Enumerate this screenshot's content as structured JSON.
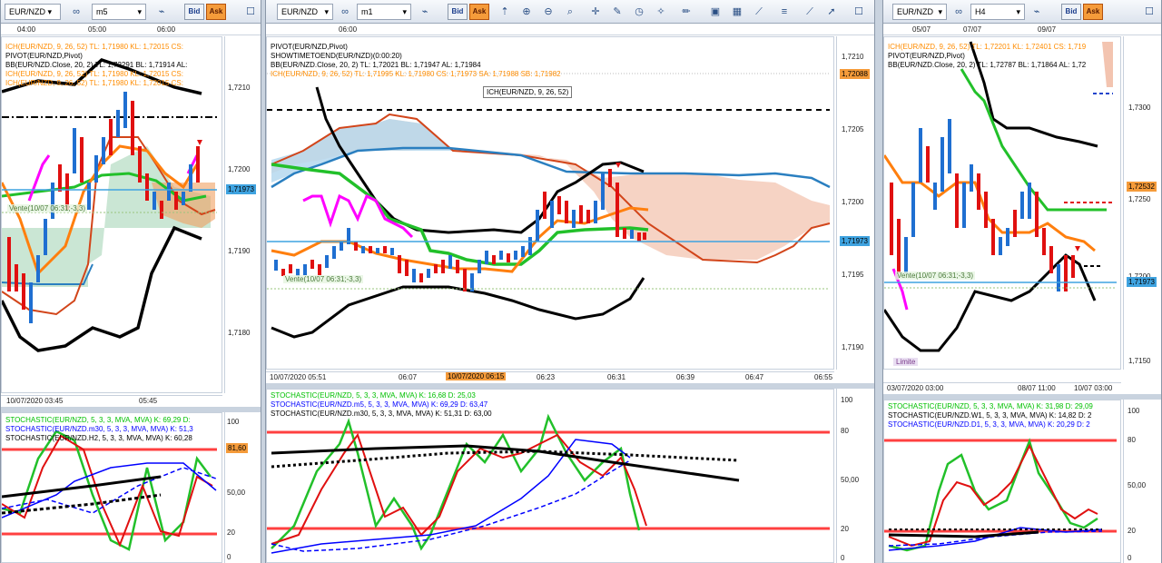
{
  "panels": [
    {
      "id": "left",
      "symbol": "EUR/NZD",
      "timeframe": "m5",
      "bid": "Bid",
      "ask": "Ask",
      "top_times": [
        "04:00",
        "05:00",
        "06:00"
      ],
      "legend": [
        {
          "text": "ICH(EUR/NZD, 9, 26, 52)  TL: 1,71980  KL: 1,72015  CS:",
          "color": "#ff8c00"
        },
        {
          "text": "PIVOT(EUR/NZD,Pivot)",
          "color": "#000000"
        },
        {
          "text": "BB(EUR/NZD.Close, 20, 2)  TL: 1,72291  BL: 1,71914  AL:",
          "color": "#000000"
        },
        {
          "text": "ICH(EUR/NZD, 9, 26, 52)  TL: 1,71980  KL: 1,72015  CS:",
          "color": "#ff8c00"
        },
        {
          "text": "ICH(EUR/NZD, 9, 26, 52)  TL: 1,71980  KL: 1,72015  CS:",
          "color": "#ff8c00"
        }
      ],
      "prices": [
        "1,7210",
        "1,7200",
        "1,7190",
        "1,7180"
      ],
      "current_price": "1,71973",
      "order_label": "Vente(10/07 06:31;-3,3)",
      "bottom_times": [
        "10/07/2020 03:45",
        "05:45"
      ],
      "stoch_legend": [
        {
          "text": "STOCHASTIC(EUR/NZD, 5, 3, 3, MVA, MVA)  K: 69,29  D:",
          "color": "#00c000"
        },
        {
          "text": "STOCHASTIC(EUR/NZD.m30, 5, 3, 3, MVA, MVA)  K: 51,3",
          "color": "#0000ff"
        },
        {
          "text": "STOCHASTIC(EUR/NZD.H2, 5, 3, 3, MVA, MVA)  K: 60,28",
          "color": "#000000"
        }
      ],
      "stoch_levels": [
        "100",
        "50,00",
        "20",
        "0"
      ],
      "stoch_highlight": "81,60"
    },
    {
      "id": "middle",
      "symbol": "EUR/NZD",
      "timeframe": "m1",
      "bid": "Bid",
      "ask": "Ask",
      "top_times": [
        "06:00"
      ],
      "legend": [
        {
          "text": "PIVOT(EUR/NZD,Pivot)",
          "color": "#000000"
        },
        {
          "text": "SHOWTIMETOEND(EUR/NZD)(0:00:20)",
          "color": "#000000"
        },
        {
          "text": "BB(EUR/NZD.Close, 20, 2)  TL: 1,72021  BL: 1,71947  AL: 1,71984",
          "color": "#000000"
        },
        {
          "text": "ICH(EUR/NZD, 9, 26, 52)  TL: 1,71995  KL: 1,71980  CS: 1,71973  SA: 1,71988  SB: 1,71982",
          "color": "#ff8c00"
        }
      ],
      "tooltip": "ICH(EUR/NZD, 9, 26, 52)",
      "prices": [
        "1,7210",
        "1,7205",
        "1,7200",
        "1,7195",
        "1,7190"
      ],
      "pivot_price": "1,72088",
      "current_price": "1,71973",
      "order_label": "Vente(10/07 06:31;-3,3)",
      "bottom_times": [
        "10/07/2020 05:51",
        "06:07",
        "10/07/2020 06:15",
        "06:23",
        "06:31",
        "06:39",
        "06:47",
        "06:55"
      ],
      "stoch_legend": [
        {
          "text": "STOCHASTIC(EUR/NZD, 5, 3, 3, MVA, MVA)  K: 16,68  D: 25,03",
          "color": "#00c000"
        },
        {
          "text": "STOCHASTIC(EUR/NZD.m5, 5, 3, 3, MVA, MVA)  K: 69,29  D: 63,47",
          "color": "#0000ff"
        },
        {
          "text": "STOCHASTIC(EUR/NZD.m30, 5, 3, 3, MVA, MVA)  K: 51,31  D: 63,00",
          "color": "#000000"
        }
      ],
      "stoch_levels": [
        "100",
        "80",
        "50,00",
        "20",
        "0"
      ]
    },
    {
      "id": "right",
      "symbol": "EUR/NZD",
      "timeframe": "H4",
      "bid": "Bid",
      "ask": "Ask",
      "top_times": [
        "05/07",
        "07/07",
        "09/07"
      ],
      "legend": [
        {
          "text": "ICH(EUR/NZD, 9, 26, 52)  TL: 1,72201  KL: 1,72401  CS: 1,719",
          "color": "#ff8c00"
        },
        {
          "text": "PIVOT(EUR/NZD,Pivot)",
          "color": "#000000"
        },
        {
          "text": "BB(EUR/NZD.Close, 20, 2)  TL: 1,72787  BL: 1,71864  AL: 1,72",
          "color": "#000000"
        }
      ],
      "prices": [
        "1,7300",
        "1,7250",
        "1,7200",
        "1,7150"
      ],
      "pivot_price": "1,72532",
      "current_price": "1,71973",
      "order_label": "Vente(10/07 06:31;-3,3)",
      "limit_label": "Limite",
      "bottom_times": [
        "03/07/2020 03:00",
        "08/07 11:00",
        "10/07 03:00"
      ],
      "stoch_legend": [
        {
          "text": "STOCHASTIC(EUR/NZD, 5, 3, 3, MVA, MVA)  K: 31,98  D: 29,09",
          "color": "#00c000"
        },
        {
          "text": "STOCHASTIC(EUR/NZD.W1, 5, 3, 3, MVA, MVA)  K: 14,82  D: 2",
          "color": "#000000"
        },
        {
          "text": "STOCHASTIC(EUR/NZD.D1, 5, 3, 3, MVA, MVA)  K: 20,29  D: 2",
          "color": "#0000ff"
        }
      ],
      "stoch_levels": [
        "100",
        "80",
        "50,00",
        "20",
        "0"
      ]
    }
  ],
  "colors": {
    "bull": "#1f6fd1",
    "bear": "#e01010",
    "tenkan": "#ff7f0e",
    "kijun": "#22c02a",
    "chikou": "#ff00ff",
    "bands": "#000000",
    "span_b": "#d2451a",
    "span_a": "#2a7fc0",
    "pivot": "#000000",
    "price_tag": "#3fa3e0",
    "pivot_tag": "#f59b3a"
  },
  "icons": [
    "symbol-dropdown-icon",
    "chart-type-icon",
    "timeframe-dropdown-icon",
    "indicator-icon",
    "crosshair-icon",
    "zoom-in-icon",
    "zoom-out-icon",
    "draw-line-icon",
    "settings-icon",
    "close-icon"
  ]
}
